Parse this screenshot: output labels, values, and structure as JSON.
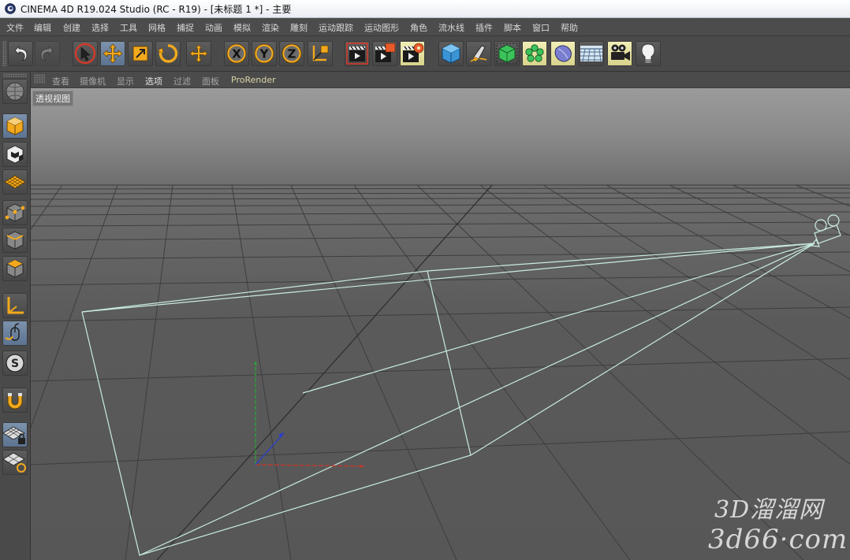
{
  "window": {
    "title": "CINEMA 4D R19.024 Studio (RC - R19) - [未标题 1 *] - 主要"
  },
  "menubar": {
    "items": [
      "文件",
      "编辑",
      "创建",
      "选择",
      "工具",
      "网格",
      "捕捉",
      "动画",
      "模拟",
      "渲染",
      "雕刻",
      "运动跟踪",
      "运动图形",
      "角色",
      "流水线",
      "插件",
      "脚本",
      "窗口",
      "帮助"
    ]
  },
  "toolbar": {
    "buttons": [
      {
        "name": "undo",
        "icon": "undo-icon"
      },
      {
        "name": "redo",
        "icon": "redo-icon"
      },
      {
        "name": "live-selection",
        "icon": "cursor-icon",
        "selected": true
      },
      {
        "name": "move",
        "icon": "move-icon",
        "selected": true
      },
      {
        "name": "scale",
        "icon": "scale-icon"
      },
      {
        "name": "rotate",
        "icon": "rotate-icon"
      },
      {
        "name": "last-tool",
        "icon": "move-small-icon"
      },
      {
        "name": "x-axis",
        "icon": "x-axis-icon",
        "label": "X"
      },
      {
        "name": "y-axis",
        "icon": "y-axis-icon",
        "label": "Y"
      },
      {
        "name": "z-axis",
        "icon": "z-axis-icon",
        "label": "Z"
      },
      {
        "name": "coordinate-system",
        "icon": "coordinate-system-icon"
      },
      {
        "name": "render-view",
        "icon": "clapper-render-icon"
      },
      {
        "name": "render-picture-viewer",
        "icon": "clapper-viewer-icon"
      },
      {
        "name": "render-settings",
        "icon": "clapper-settings-icon"
      },
      {
        "name": "cube",
        "icon": "cube-icon"
      },
      {
        "name": "pen",
        "icon": "pen-icon"
      },
      {
        "name": "subdivision",
        "icon": "subdivision-icon"
      },
      {
        "name": "cloner",
        "icon": "cloner-icon"
      },
      {
        "name": "deformer",
        "icon": "deformer-icon"
      },
      {
        "name": "floor",
        "icon": "floor-icon"
      },
      {
        "name": "camera",
        "icon": "camera-icon"
      },
      {
        "name": "light",
        "icon": "light-bulb-icon"
      }
    ]
  },
  "left_panel": {
    "buttons": [
      {
        "name": "make-editable",
        "icon": "make-editable-icon"
      },
      {
        "name": "model-mode",
        "icon": "model-mode-icon",
        "selected": true
      },
      {
        "name": "texture-mode",
        "icon": "texture-mode-icon"
      },
      {
        "name": "workplane-mode",
        "icon": "workplane-icon"
      },
      {
        "name": "points-mode",
        "icon": "points-mode-icon"
      },
      {
        "name": "edges-mode",
        "icon": "edges-mode-icon"
      },
      {
        "name": "polygons-mode",
        "icon": "polygons-mode-icon"
      },
      {
        "name": "axis-mode",
        "icon": "axis-mode-icon"
      },
      {
        "name": "tweak-mode",
        "icon": "tweak-mode-icon",
        "selected": true
      },
      {
        "name": "solo",
        "icon": "solo-icon"
      },
      {
        "name": "snap",
        "icon": "magnet-icon"
      },
      {
        "name": "workplane-lock",
        "icon": "workplane-lock-icon"
      },
      {
        "name": "workplane-align",
        "icon": "workplane-align-icon"
      }
    ]
  },
  "viewport_menu": {
    "items": [
      "查看",
      "摄像机",
      "显示",
      "选项",
      "过滤",
      "面板",
      "ProRender"
    ]
  },
  "viewport": {
    "label": "透视视图"
  },
  "watermark": {
    "line1": "3D溜溜网",
    "line2": "3d66·com"
  },
  "colors": {
    "selected_button": "#6c84a2",
    "active_menu_text": "#e3e3e3",
    "prorender_text": "#d9d7a6",
    "camera_wireframe": "#c9ecdf",
    "axis_x": "#c0392b",
    "axis_y": "#2e9e3a",
    "axis_z": "#2d3fc4"
  }
}
